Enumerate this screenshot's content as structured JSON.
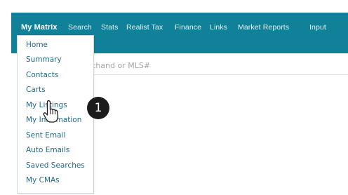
{
  "nav": {
    "items": [
      "My Matrix",
      "Search",
      "Stats",
      "Realist Tax",
      "Finance",
      "Links",
      "Market Reports",
      "Input"
    ]
  },
  "search": {
    "placeholder": "thand or MLS#"
  },
  "menu": {
    "items": [
      "Home",
      "Summary",
      "Contacts",
      "Carts",
      "My Listings",
      "My Information",
      "Sent Email",
      "Auto Emails",
      "Saved Searches",
      "My CMAs"
    ]
  },
  "badge": {
    "label": "1"
  },
  "icons": {
    "cursor": "hand-pointer-icon"
  },
  "colors": {
    "nav_bg": "#11819a",
    "menu_text": "#236b86",
    "badge_bg": "#1b1b1b"
  }
}
